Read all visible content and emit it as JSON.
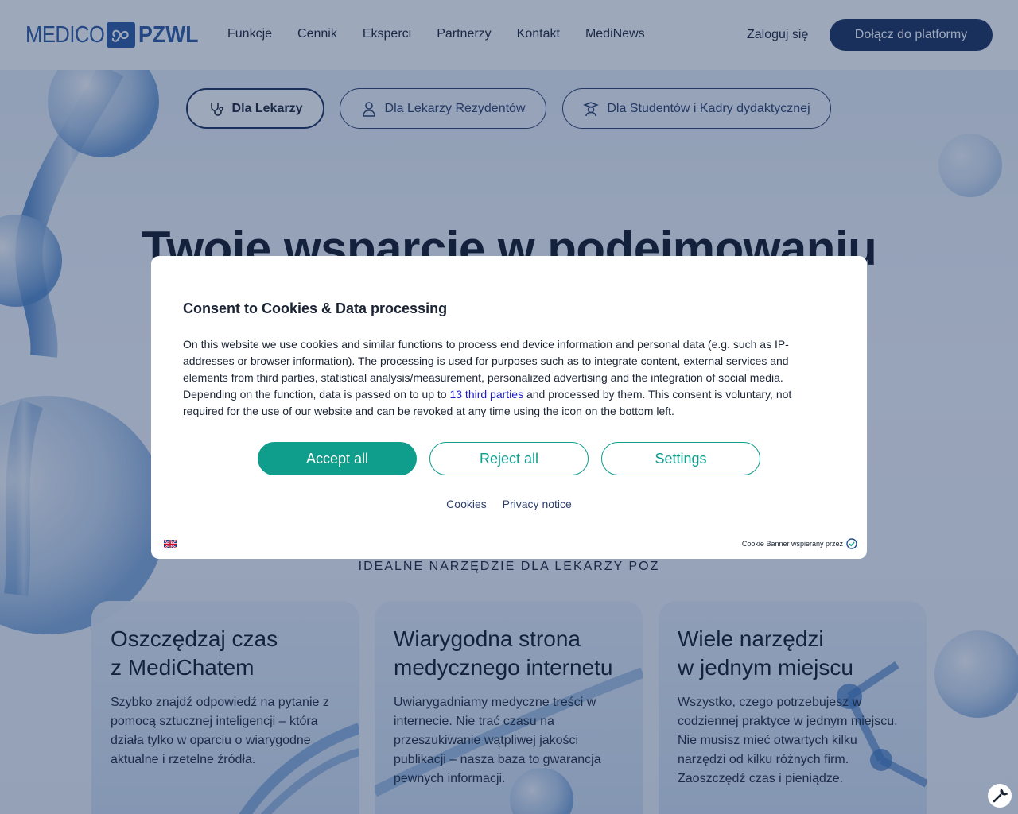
{
  "header": {
    "logo_left": "MEDICO",
    "logo_right": "PZWL",
    "nav": [
      "Funkcje",
      "Cennik",
      "Eksperci",
      "Partnerzy",
      "Kontakt",
      "MediNews"
    ],
    "login_label": "Zaloguj się",
    "join_label": "Dołącz do platformy"
  },
  "audience_tabs": [
    {
      "label": "Dla Lekarzy",
      "icon": "stethoscope-icon",
      "active": true
    },
    {
      "label": "Dla Lekarzy Rezydentów",
      "icon": "doctor-icon",
      "active": false
    },
    {
      "label": "Dla Studentów i Kadry dydaktycznej",
      "icon": "student-icon",
      "active": false
    }
  ],
  "hero": {
    "title": "Twoje wsparcie w podejmowaniu",
    "subtitle": "IDEALNE NARZĘDZIE DLA LEKARZY POZ"
  },
  "cards": [
    {
      "title_line1": "Oszczędzaj czas",
      "title_line2": "z MediChatem",
      "body": "Szybko znajdź odpowiedź na pytanie z pomocą sztucznej inteligencji – która działa tylko w oparciu o wiarygodne aktualne i rzetelne źródła."
    },
    {
      "title_line1": "Wiarygodna strona",
      "title_line2": "medycznego internetu",
      "body": "Uwiarygadniamy medyczne treści w internecie. Nie trać czasu na przeszukiwanie wątpliwej jakości publikacji – nasza baza to gwarancja pewnych informacji."
    },
    {
      "title_line1": "Wiele narzędzi",
      "title_line2": "w jednym miejscu",
      "body": "Wszystko, czego potrzebujesz w codziennej praktyce w jednym miejscu. Nie musisz mieć otwartych kilku narzędzi od kilku różnych firm. Zaoszczędź czas i pieniądze."
    }
  ],
  "consent": {
    "title": "Consent to Cookies & Data processing",
    "text_before_link": "On this website we use cookies and similar functions to process end device information and personal data (e.g. such as IP-addresses or browser information). The processing is used for purposes such as to integrate content, external services and elements from third parties, statistical analysis/measurement, personalized advertising and the integration of social media. Depending on the function, data is passed on to up to ",
    "link_label": "13 third parties",
    "text_after_link": " and processed by them. This consent is voluntary, not required for the use of our website and can be revoked at any time using the icon on the bottom left.",
    "accept_label": "Accept all",
    "reject_label": "Reject all",
    "settings_label": "Settings",
    "cookies_link": "Cookies",
    "privacy_link": "Privacy notice",
    "powered_by": "Cookie Banner wspierany przez",
    "language_flag": "uk-flag-icon"
  },
  "colors": {
    "brand_blue": "#2c5aa0",
    "navy": "#1b2f5c",
    "accent_teal": "#0f9d8c",
    "overlay": "rgba(25,48,92,0.42)"
  }
}
